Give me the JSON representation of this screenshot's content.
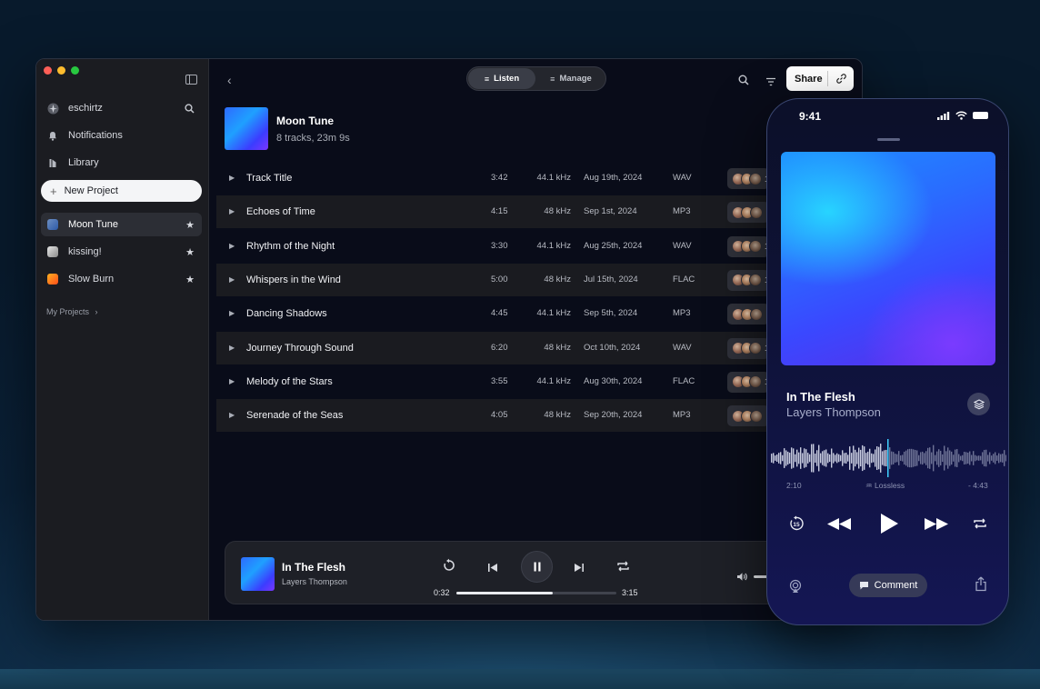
{
  "sidebar": {
    "user": "eschirtz",
    "nav": [
      {
        "label": "Notifications",
        "icon": "bell-icon"
      },
      {
        "label": "Library",
        "icon": "library-icon"
      }
    ],
    "new_project_label": "New Project",
    "projects": [
      {
        "label": "Moon Tune",
        "active": true
      },
      {
        "label": "kissing!",
        "active": false
      },
      {
        "label": "Slow Burn",
        "active": false
      }
    ],
    "my_projects_label": "My Projects"
  },
  "toolbar": {
    "listen_label": "Listen",
    "manage_label": "Manage",
    "share_label": "Share"
  },
  "project": {
    "title": "Moon Tune",
    "subtitle": "8 tracks, 23m 9s"
  },
  "tracks": [
    {
      "title": "Track Title",
      "duration": "3:42",
      "rate": "44.1 kHz",
      "date": "Aug 19th, 2024",
      "format": "WAV",
      "avatars": "1"
    },
    {
      "title": "Echoes of Time",
      "duration": "4:15",
      "rate": "48 kHz",
      "date": "Sep 1st, 2024",
      "format": "MP3",
      "avatars": ""
    },
    {
      "title": "Rhythm of the Night",
      "duration": "3:30",
      "rate": "44.1 kHz",
      "date": "Aug 25th, 2024",
      "format": "WAV",
      "avatars": "1"
    },
    {
      "title": "Whispers in the Wind",
      "duration": "5:00",
      "rate": "48 kHz",
      "date": "Jul 15th, 2024",
      "format": "FLAC",
      "avatars": "1"
    },
    {
      "title": "Dancing Shadows",
      "duration": "4:45",
      "rate": "44.1 kHz",
      "date": "Sep 5th, 2024",
      "format": "MP3",
      "avatars": ""
    },
    {
      "title": "Journey Through Sound",
      "duration": "6:20",
      "rate": "48 kHz",
      "date": "Oct 10th, 2024",
      "format": "WAV",
      "avatars": "1"
    },
    {
      "title": "Melody of the Stars",
      "duration": "3:55",
      "rate": "44.1 kHz",
      "date": "Aug 30th, 2024",
      "format": "FLAC",
      "avatars": "1"
    },
    {
      "title": "Serenade of the Seas",
      "duration": "4:05",
      "rate": "48 kHz",
      "date": "Sep 20th, 2024",
      "format": "MP3",
      "avatars": ""
    }
  ],
  "player": {
    "title": "In The Flesh",
    "artist": "Layers Thompson",
    "elapsed": "0:32",
    "total": "3:15",
    "progress": 0.6
  },
  "phone": {
    "time": "9:41",
    "title": "In The Flesh",
    "artist": "Layers Thompson",
    "elapsed": "2:10",
    "quality": "Lossless",
    "remaining": "- 4:43",
    "comment_label": "Comment",
    "skip_seconds": "15"
  },
  "colors": {
    "accent": "#2e6bff",
    "background": "#0a2036"
  }
}
